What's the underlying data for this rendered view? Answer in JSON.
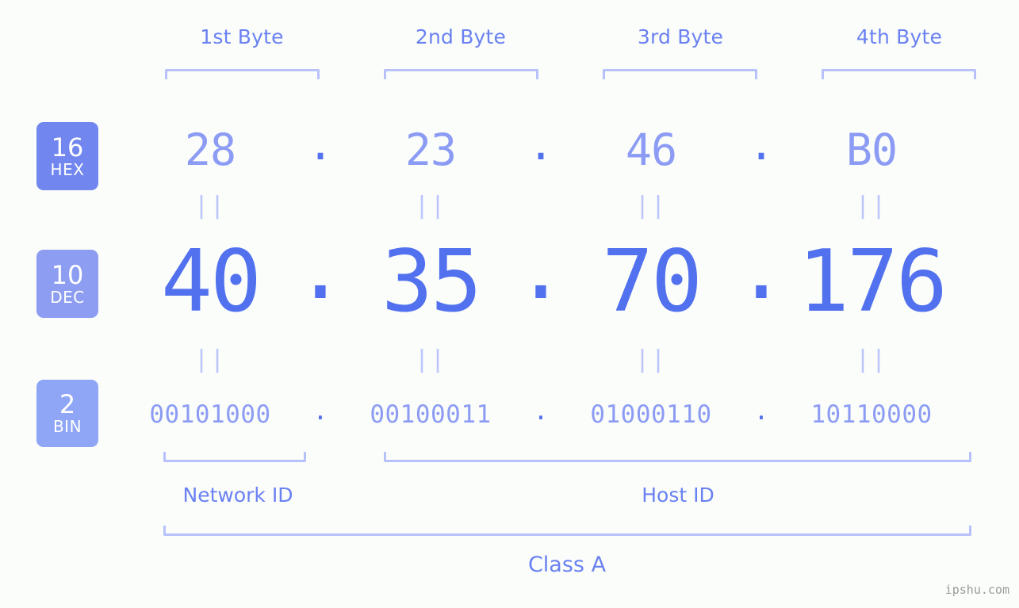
{
  "watermark": "ipshu.com",
  "byte_headers": [
    {
      "label": "1st Byte"
    },
    {
      "label": "2nd Byte"
    },
    {
      "label": "3rd Byte"
    },
    {
      "label": "4th Byte"
    }
  ],
  "bases": {
    "hex": {
      "number": "16",
      "name": "HEX",
      "color": "#7186ee"
    },
    "dec": {
      "number": "10",
      "name": "DEC",
      "color": "#8d9df2"
    },
    "bin": {
      "number": "2",
      "name": "BIN",
      "color": "#8fa5f5"
    }
  },
  "separator": ".",
  "equals_glyph": "||",
  "rows": {
    "hex": {
      "values": [
        "28",
        "23",
        "46",
        "B0"
      ]
    },
    "dec": {
      "values": [
        "40",
        "35",
        "70",
        "176"
      ]
    },
    "bin": {
      "values": [
        "00101000",
        "00100011",
        "01000110",
        "10110000"
      ]
    }
  },
  "id_sections": {
    "network": "Network ID",
    "host": "Host ID"
  },
  "class_label": "Class A",
  "colors": {
    "background": "#fbfdfa",
    "accent_strong": "#5271ee",
    "accent_medium": "#6a81f2",
    "accent_light": "#8c9cf4",
    "accent_pale": "#b7c1fb",
    "watermark": "#9b9b9b"
  }
}
